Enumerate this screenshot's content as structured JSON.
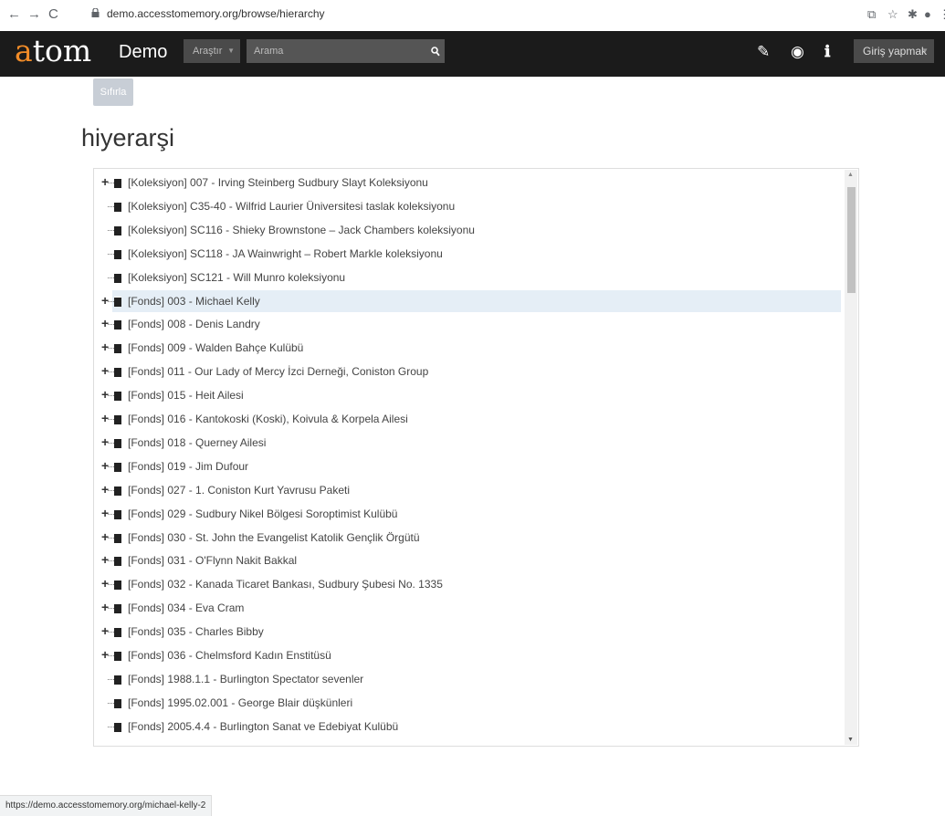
{
  "browser": {
    "url": "demo.accesstomemory.org/browse/hierarchy",
    "status_url": "https://demo.accesstomemory.org/michael-kelly-2"
  },
  "header": {
    "logo_a": "a",
    "logo_rest": "tom",
    "site_name": "Demo",
    "browse_label": "Araştır",
    "search_placeholder": "Arama",
    "login_label": "Giriş yapmak"
  },
  "page": {
    "reset_label": "Sıfırla",
    "title": "hiyerarşi"
  },
  "tree": {
    "items": [
      {
        "label": "[Koleksiyon] 007 - Irving Steinberg Sudbury Slayt Koleksiyonu",
        "expandable": true
      },
      {
        "label": "[Koleksiyon] C35-40 - Wilfrid Laurier Üniversitesi taslak koleksiyonu",
        "expandable": false
      },
      {
        "label": "[Koleksiyon] SC116 - Shieky Brownstone – Jack Chambers koleksiyonu",
        "expandable": false
      },
      {
        "label": "[Koleksiyon] SC118 - JA Wainwright – Robert Markle koleksiyonu",
        "expandable": false
      },
      {
        "label": "[Koleksiyon] SC121 - Will Munro koleksiyonu",
        "expandable": false
      },
      {
        "label": "[Fonds] 003 - Michael Kelly",
        "expandable": true,
        "active": true
      },
      {
        "label": "[Fonds] 008 - Denis Landry",
        "expandable": true
      },
      {
        "label": "[Fonds] 009 - Walden Bahçe Kulübü",
        "expandable": true
      },
      {
        "label": "[Fonds] 011 - Our Lady of Mercy İzci Derneği, Coniston Group",
        "expandable": true
      },
      {
        "label": "[Fonds] 015 - Heit Ailesi",
        "expandable": true
      },
      {
        "label": "[Fonds] 016 - Kantokoski (Koski), Koivula & Korpela Ailesi",
        "expandable": true
      },
      {
        "label": "[Fonds] 018 - Querney Ailesi",
        "expandable": true
      },
      {
        "label": "[Fonds] 019 - Jim Dufour",
        "expandable": true
      },
      {
        "label": "[Fonds] 027 - 1. Coniston Kurt Yavrusu Paketi",
        "expandable": true
      },
      {
        "label": "[Fonds] 029 - Sudbury Nikel Bölgesi Soroptimist Kulübü",
        "expandable": true
      },
      {
        "label": "[Fonds] 030 - St. John the Evangelist Katolik Gençlik Örgütü",
        "expandable": true
      },
      {
        "label": "[Fonds] 031 - O'Flynn Nakit Bakkal",
        "expandable": true
      },
      {
        "label": "[Fonds] 032 - Kanada Ticaret Bankası, Sudbury Şubesi No. 1335",
        "expandable": true
      },
      {
        "label": "[Fonds] 034 - Eva Cram",
        "expandable": true
      },
      {
        "label": "[Fonds] 035 - Charles Bibby",
        "expandable": true
      },
      {
        "label": "[Fonds] 036 - Chelmsford Kadın Enstitüsü",
        "expandable": true
      },
      {
        "label": "[Fonds] 1988.1.1 - Burlington Spectator sevenler",
        "expandable": false
      },
      {
        "label": "[Fonds] 1995.02.001 - George Blair düşkünleri",
        "expandable": false
      },
      {
        "label": "[Fonds] 2005.4.4 - Burlington Sanat ve Edebiyat Kulübü",
        "expandable": false
      }
    ]
  }
}
